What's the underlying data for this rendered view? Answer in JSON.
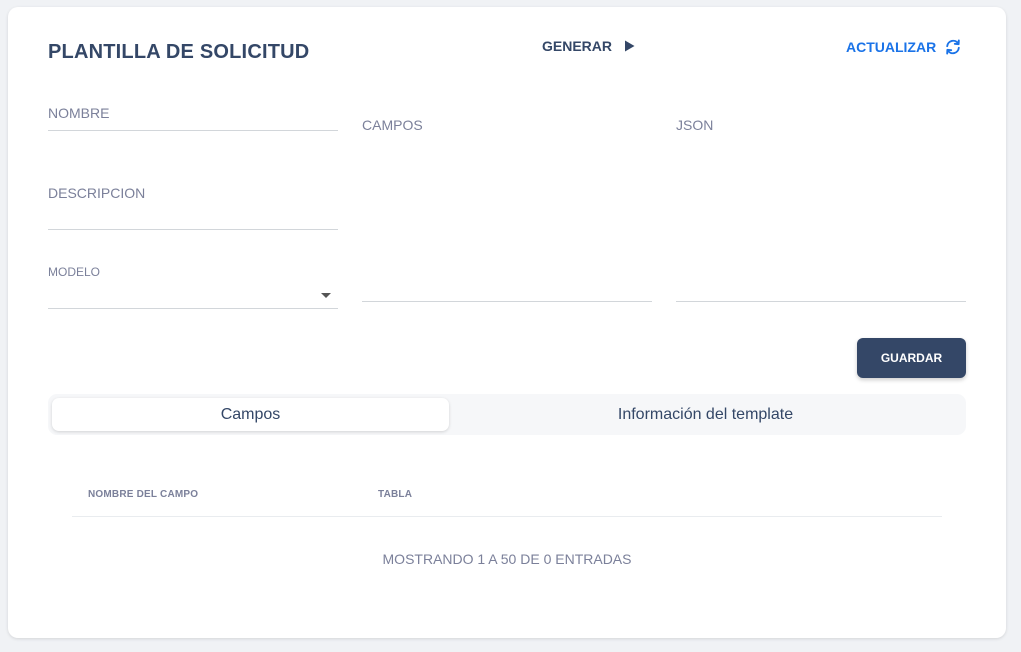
{
  "header": {
    "title": "PLANTILLA DE SOLICITUD",
    "generar_label": "GENERAR",
    "actualizar_label": "ACTUALIZAR"
  },
  "form": {
    "nombre_label": "NOMBRE",
    "nombre_value": "",
    "descripcion_label": "DESCRIPCION",
    "descripcion_value": "",
    "modelo_label": "MODELO",
    "modelo_value": "",
    "campos_label": "CAMPOS",
    "campos_value": "",
    "json_label": "JSON",
    "json_value": "",
    "guardar_label": "GUARDAR"
  },
  "tabs": [
    {
      "label": "Campos",
      "active": true
    },
    {
      "label": "Información del template",
      "active": false
    }
  ],
  "table": {
    "columns": [
      "NOMBRE DEL CAMPO",
      "TABLA"
    ],
    "rows": [],
    "footer": "MOSTRANDO 1 A 50 DE 0 ENTRADAS"
  },
  "colors": {
    "primary_dark": "#344767",
    "accent_blue": "#1a73e8",
    "muted": "#7b809a"
  },
  "icons": {
    "generar": "play-icon",
    "actualizar": "refresh-icon",
    "modelo": "chevron-down-icon"
  }
}
